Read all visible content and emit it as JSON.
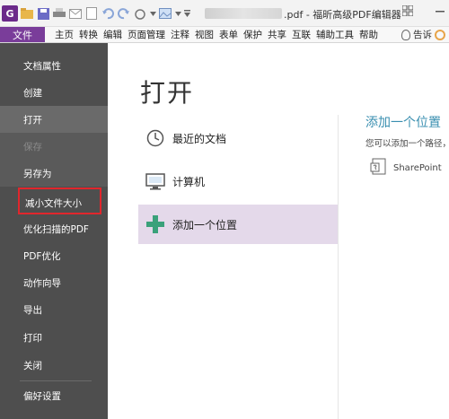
{
  "window": {
    "title_suffix": ".pdf - 福昕高级PDF编辑器"
  },
  "menubar": {
    "file": "文件",
    "items": [
      "主页",
      "转换",
      "编辑",
      "页面管理",
      "注释",
      "视图",
      "表单",
      "保护",
      "共享",
      "互联",
      "辅助工具",
      "帮助"
    ],
    "tell_me": "告诉"
  },
  "sidebar": {
    "items": [
      {
        "label": "文档属性"
      },
      {
        "label": "创建"
      },
      {
        "label": "打开"
      },
      {
        "label": "保存"
      },
      {
        "label": "另存为"
      },
      {
        "label": "减小文件大小"
      },
      {
        "label": "优化扫描的PDF"
      },
      {
        "label": "PDF优化"
      },
      {
        "label": "动作向导"
      },
      {
        "label": "导出"
      },
      {
        "label": "打印"
      },
      {
        "label": "关闭"
      },
      {
        "label": "偏好设置"
      }
    ]
  },
  "main": {
    "title": "打开",
    "options": [
      {
        "label": "最近的文档",
        "icon": "clock-icon"
      },
      {
        "label": "计算机",
        "icon": "computer-icon"
      },
      {
        "label": "添加一个位置",
        "icon": "plus-icon"
      }
    ]
  },
  "right_panel": {
    "title": "添加一个位置",
    "description": "您可以添加一个路径，",
    "sharepoint": "SharePoint"
  },
  "colors": {
    "accent": "#7a3d9a",
    "sidebar_bg": "#4e4e4e",
    "selected_bg": "#e4d9ea",
    "highlight": "#e1262c",
    "link": "#3a8fb0"
  }
}
